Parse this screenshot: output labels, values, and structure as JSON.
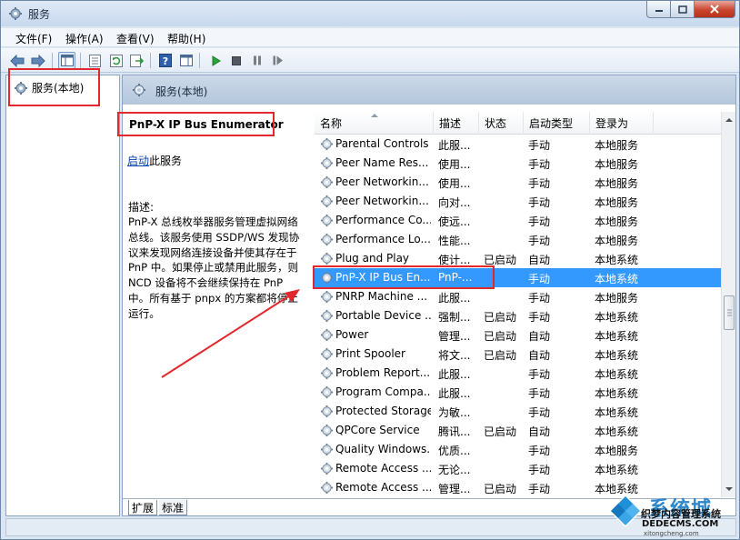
{
  "window": {
    "title": "服务"
  },
  "menu": [
    "文件(F)",
    "操作(A)",
    "查看(V)",
    "帮助(H)"
  ],
  "tree": {
    "label": "服务(本地)"
  },
  "header": {
    "title": "服务(本地)"
  },
  "details": {
    "name": "PnP-X IP Bus Enumerator",
    "start_link": "启动",
    "start_suffix": "此服务",
    "desc_label": "描述:",
    "desc_text": "PnP-X 总线枚举器服务管理虚拟网络总线。该服务使用 SSDP/WS 发现协议来发现网络连接设备并使其存在于 PnP 中。如果停止或禁用此服务，则 NCD 设备将不会继续保持在 PnP 中。所有基于 pnpx 的方案都将停止运行。"
  },
  "columns": [
    "名称",
    "描述",
    "状态",
    "启动类型",
    "登录为"
  ],
  "rows": [
    {
      "name": "Parental Controls",
      "desc": "此服...",
      "status": "",
      "start": "手动",
      "logon": "本地服务"
    },
    {
      "name": "Peer Name Res...",
      "desc": "使用...",
      "status": "",
      "start": "手动",
      "logon": "本地服务"
    },
    {
      "name": "Peer Networkin...",
      "desc": "使用...",
      "status": "",
      "start": "手动",
      "logon": "本地服务"
    },
    {
      "name": "Peer Networkin...",
      "desc": "向对...",
      "status": "",
      "start": "手动",
      "logon": "本地服务"
    },
    {
      "name": "Performance Co...",
      "desc": "使远...",
      "status": "",
      "start": "手动",
      "logon": "本地服务"
    },
    {
      "name": "Performance Lo...",
      "desc": "性能...",
      "status": "",
      "start": "手动",
      "logon": "本地服务"
    },
    {
      "name": "Plug and Play",
      "desc": "使计...",
      "status": "已启动",
      "start": "自动",
      "logon": "本地系统"
    },
    {
      "name": "PnP-X IP Bus En...",
      "desc": "PnP-...",
      "status": "",
      "start": "手动",
      "logon": "本地系统",
      "selected": true
    },
    {
      "name": "PNRP Machine ...",
      "desc": "此服...",
      "status": "",
      "start": "手动",
      "logon": "本地服务"
    },
    {
      "name": "Portable Device ...",
      "desc": "强制...",
      "status": "已启动",
      "start": "手动",
      "logon": "本地系统"
    },
    {
      "name": "Power",
      "desc": "管理...",
      "status": "已启动",
      "start": "自动",
      "logon": "本地系统"
    },
    {
      "name": "Print Spooler",
      "desc": "将文...",
      "status": "已启动",
      "start": "自动",
      "logon": "本地系统"
    },
    {
      "name": "Problem Report...",
      "desc": "此服...",
      "status": "",
      "start": "手动",
      "logon": "本地系统"
    },
    {
      "name": "Program Compa...",
      "desc": "此服...",
      "status": "",
      "start": "手动",
      "logon": "本地系统"
    },
    {
      "name": "Protected Storage",
      "desc": "为敏...",
      "status": "",
      "start": "手动",
      "logon": "本地系统"
    },
    {
      "name": "QPCore Service",
      "desc": "腾讯...",
      "status": "已启动",
      "start": "自动",
      "logon": "本地系统"
    },
    {
      "name": "Quality Windows...",
      "desc": "优质...",
      "status": "",
      "start": "手动",
      "logon": "本地服务"
    },
    {
      "name": "Remote Access ...",
      "desc": "无论...",
      "status": "",
      "start": "手动",
      "logon": "本地系统"
    },
    {
      "name": "Remote Access ...",
      "desc": "管理...",
      "status": "已启动",
      "start": "手动",
      "logon": "本地系统"
    }
  ],
  "tabs": [
    "扩展",
    "标准"
  ],
  "watermark": {
    "title": "系统城",
    "line1": "织梦内容管理系统",
    "line2": "DEDECMS.COM",
    "line3": "xitongcheng.com"
  },
  "colors": {
    "selection": "#3399ff",
    "highlight_red": "#e1282c",
    "link": "#0645ad"
  }
}
